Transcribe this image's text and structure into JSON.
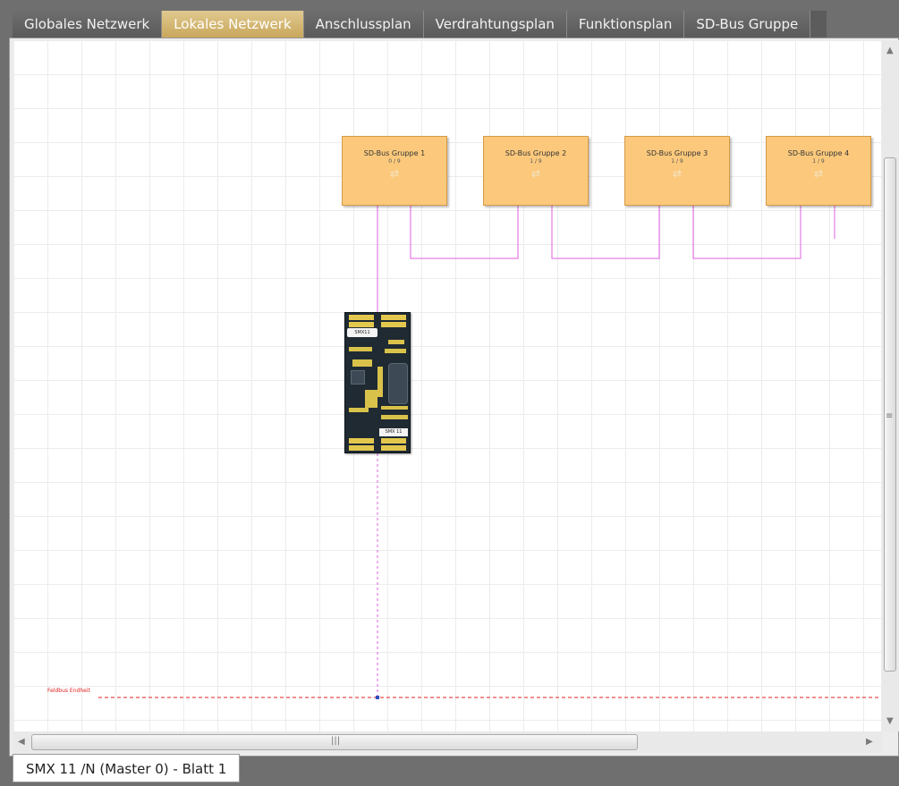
{
  "tabs": [
    {
      "label": "Globales Netzwerk",
      "active": false
    },
    {
      "label": "Lokales Netzwerk",
      "active": true
    },
    {
      "label": "Anschlussplan",
      "active": false
    },
    {
      "label": "Verdrahtungsplan",
      "active": false
    },
    {
      "label": "Funktionsplan",
      "active": false
    },
    {
      "label": "SD-Bus Gruppe",
      "active": false
    }
  ],
  "bus_groups": [
    {
      "name": "SD-Bus Gruppe 1",
      "count": "0 / 9"
    },
    {
      "name": "SD-Bus Gruppe 2",
      "count": "1 / 9"
    },
    {
      "name": "SD-Bus Gruppe 3",
      "count": "1 / 9"
    },
    {
      "name": "SD-Bus Gruppe 4",
      "count": "1 / 9"
    }
  ],
  "device": {
    "label": "SMX11",
    "model": "SMX 11"
  },
  "end_marker_label": "Feldbus Endheit",
  "sheet_tab_label": "SMX 11 /N (Master 0) - Blatt 1",
  "colors": {
    "bus_box_fill": "#fcc97c",
    "bus_line": "#e060e0",
    "end_line": "#e02020",
    "active_tab": "#c9a75c"
  },
  "icons": {
    "scroll_up": "▲",
    "scroll_down": "▼",
    "scroll_left": "◀",
    "scroll_right": "▶",
    "grip_vertical": "≡",
    "grip_horizontal": "|||",
    "bus_glyph": "⇄"
  }
}
